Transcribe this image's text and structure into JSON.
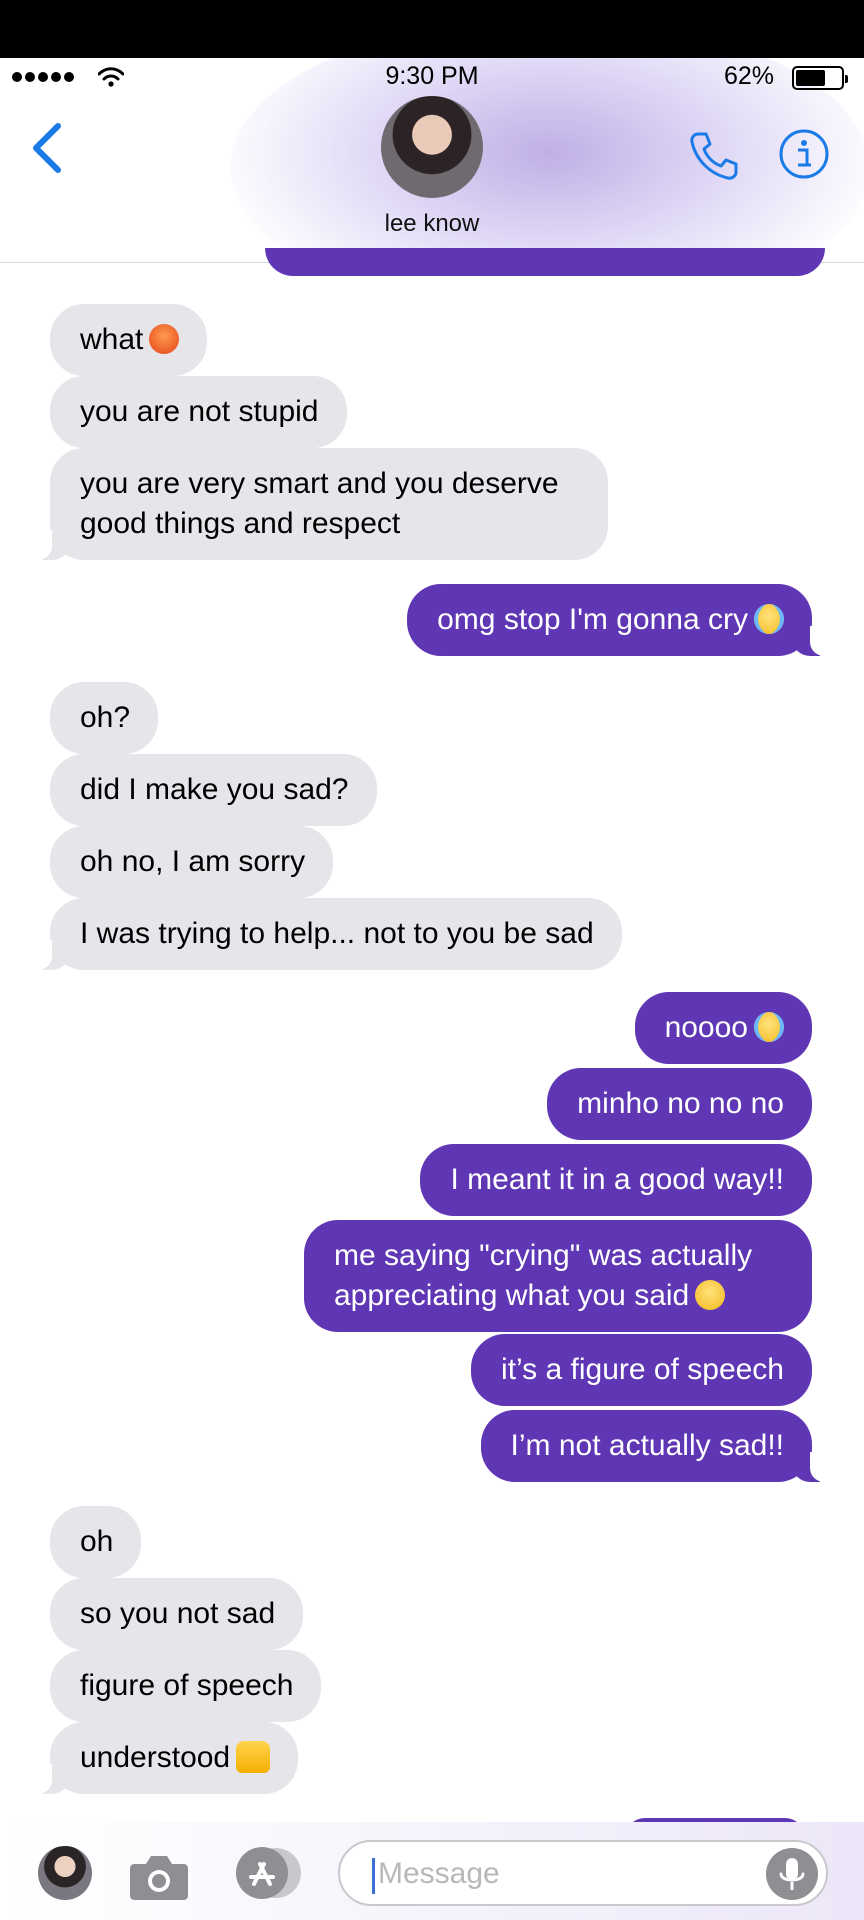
{
  "status_bar": {
    "time": "9:30 PM",
    "battery": "62%"
  },
  "header": {
    "contact_name": "lee know"
  },
  "messages": [
    {
      "dir": "in",
      "text": "what",
      "emoji": "angry-face-emoji"
    },
    {
      "dir": "in",
      "text": "you are not stupid"
    },
    {
      "dir": "in",
      "text": "you are very smart and you deserve good things and respect"
    },
    {
      "dir": "out",
      "text": "omg stop I'm gonna cry",
      "emoji": "loudly-crying-face-emoji"
    },
    {
      "dir": "in",
      "text": "oh?"
    },
    {
      "dir": "in",
      "text": "did I make you sad?"
    },
    {
      "dir": "in",
      "text": "oh no, I am sorry"
    },
    {
      "dir": "in",
      "text": "I was trying to help... not to you be sad"
    },
    {
      "dir": "out",
      "text": "noooo",
      "emoji": "loudly-crying-face-emoji"
    },
    {
      "dir": "out",
      "text": "minho no no no"
    },
    {
      "dir": "out",
      "text": "I meant it in a good way!!"
    },
    {
      "dir": "out",
      "text": "me saying \"crying\" was actually appreciating what you said",
      "emoji": "pleading-face-emoji"
    },
    {
      "dir": "out",
      "text": "it’s a figure of speech"
    },
    {
      "dir": "out",
      "text": "I’m not actually sad!!"
    },
    {
      "dir": "in",
      "text": "oh"
    },
    {
      "dir": "in",
      "text": "so you not sad"
    },
    {
      "dir": "in",
      "text": "figure of speech"
    },
    {
      "dir": "in",
      "text": "understood",
      "emoji": "thumbs-up-emoji"
    }
  ],
  "input": {
    "placeholder": "Message"
  },
  "colors": {
    "outgoing_bubble": "#5f37b5",
    "incoming_bubble": "#e5e5ea",
    "accent": "#1a7ae8"
  }
}
